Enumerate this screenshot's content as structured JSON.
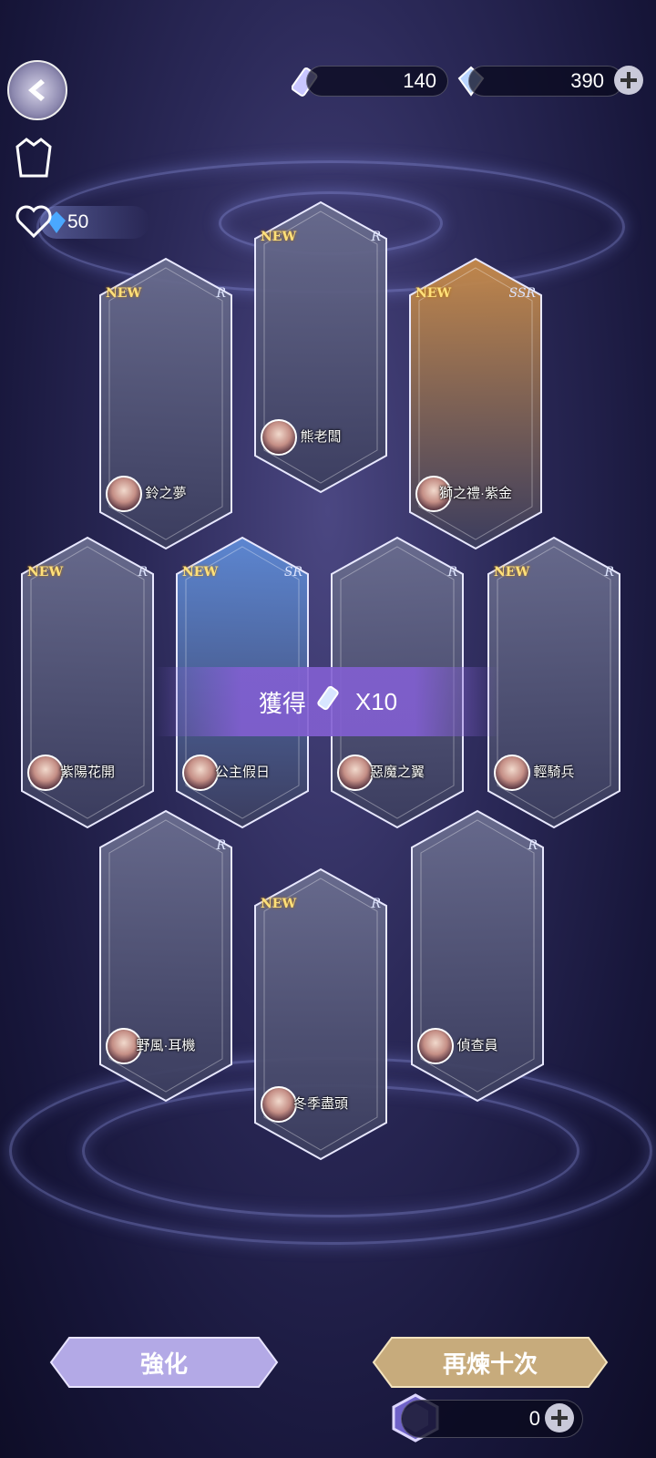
{
  "top_bar": {
    "ticket_count": "140",
    "crystal_count": "390"
  },
  "side": {
    "heart_points": "50"
  },
  "cards": [
    {
      "name": "鈴之夢",
      "new": "NEW",
      "rarity": "R"
    },
    {
      "name": "熊老闆",
      "new": "NEW",
      "rarity": "R"
    },
    {
      "name": "獅之禮·紫金",
      "new": "NEW",
      "rarity": "SSR"
    },
    {
      "name": "紫陽花開",
      "new": "NEW",
      "rarity": "R"
    },
    {
      "name": "公主假日",
      "new": "NEW",
      "rarity": "SR"
    },
    {
      "name": "惡魔之翼",
      "new": "",
      "rarity": "R"
    },
    {
      "name": "輕騎兵",
      "new": "NEW",
      "rarity": "R"
    },
    {
      "name": "野風·耳機",
      "new": "",
      "rarity": "R"
    },
    {
      "name": "冬季盡頭",
      "new": "NEW",
      "rarity": "R"
    },
    {
      "name": "偵查員",
      "new": "",
      "rarity": "R"
    }
  ],
  "obtain_banner": {
    "label": "獲得",
    "amount": "X10"
  },
  "buttons": {
    "enhance": "強化",
    "refine_ten": "再煉十次"
  },
  "material": {
    "count": "0"
  }
}
